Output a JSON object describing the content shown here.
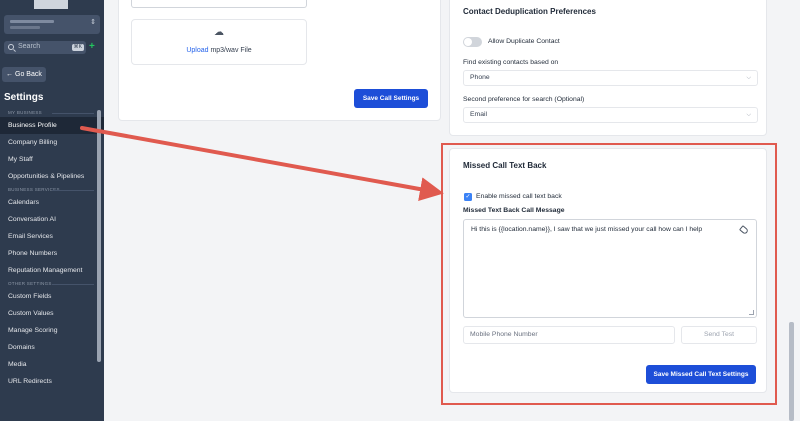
{
  "sidebar": {
    "search": {
      "label": "Search",
      "shortcut": "⌘K",
      "add": "+"
    },
    "go_back": "Go Back",
    "title": "Settings",
    "sections": [
      {
        "label": "MY BUSINESS",
        "items": [
          {
            "label": "Business Profile",
            "active": true
          },
          {
            "label": "Company Billing"
          },
          {
            "label": "My Staff"
          },
          {
            "label": "Opportunities & Pipelines"
          }
        ]
      },
      {
        "label": "BUSINESS SERVICES",
        "items": [
          {
            "label": "Calendars"
          },
          {
            "label": "Conversation AI"
          },
          {
            "label": "Email Services"
          },
          {
            "label": "Phone Numbers"
          },
          {
            "label": "Reputation Management"
          }
        ]
      },
      {
        "label": "OTHER SETTINGS",
        "items": [
          {
            "label": "Custom Fields"
          },
          {
            "label": "Custom Values"
          },
          {
            "label": "Manage Scoring"
          },
          {
            "label": "Domains"
          },
          {
            "label": "Media"
          },
          {
            "label": "URL Redirects"
          }
        ]
      }
    ]
  },
  "call_settings": {
    "upload_link": "Upload",
    "upload_text": " mp3/wav File",
    "save_button": "Save Call Settings"
  },
  "dedup": {
    "title": "Contact Deduplication Preferences",
    "toggle_label": "Allow Duplicate Contact",
    "toggle_on": false,
    "find_label": "Find existing contacts based on",
    "find_value": "Phone",
    "second_label": "Second preference for search (Optional)",
    "second_value": "Email"
  },
  "missed_call": {
    "title": "Missed Call Text Back",
    "enable_label": "Enable missed call text back",
    "enabled": true,
    "message_label": "Missed Text Back Call Message",
    "message": "Hi this is {{location.name}}, I saw that we just missed your call how can I help",
    "phone_placeholder": "Mobile Phone Number",
    "send_test": "Send Test",
    "save_button": "Save Missed Call Text Settings"
  },
  "annotation": {
    "color": "#e05a4f"
  }
}
